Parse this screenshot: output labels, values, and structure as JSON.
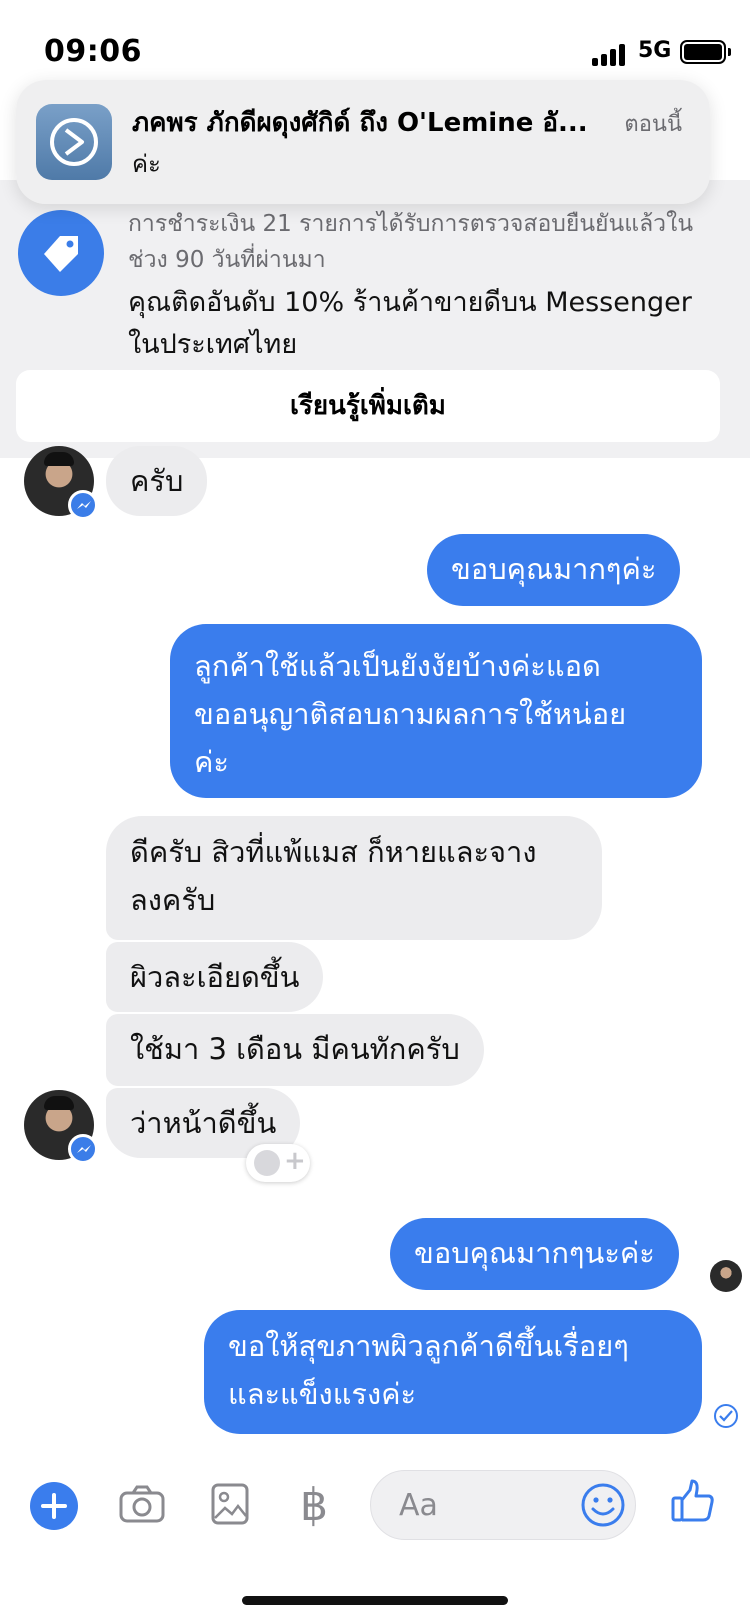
{
  "status_bar": {
    "time": "09:06",
    "network": "5G"
  },
  "notification": {
    "title": "ภคพร ภักดีผดุงศักิด์ ถึง O'Lemine อั...",
    "body": "ค่ะ",
    "time": "ตอนนี้"
  },
  "banner": {
    "verify_text": "การชำระเงิน 21 รายการได้รับการตรวจสอบยืนยันแล้วในช่วง 90 วันที่ผ่านมา",
    "rank_text": "คุณติดอันดับ 10% ร้านค้าขายดีบน Messenger ในประเทศไทย",
    "learn_more": "เรียนรู้เพิ่มเติม"
  },
  "messages": [
    {
      "side": "incoming",
      "text": "ครับ"
    },
    {
      "side": "outgoing",
      "text": "ขอบคุณมากๆค่ะ"
    },
    {
      "side": "outgoing",
      "lines": [
        "ลูกค้าใช้แล้วเป็นยังงัยบ้างค่ะแอด",
        "ขออนุญาติสอบถามผลการใช้หน่อย",
        "ค่ะ"
      ]
    },
    {
      "side": "incoming",
      "lines": [
        "ดีครับ สิวที่แพ้แมส ก็หายและจาง",
        "ลงครับ"
      ]
    },
    {
      "side": "incoming",
      "text": "ผิวละเอียดขึ้น"
    },
    {
      "side": "incoming",
      "text": "ใช้มา 3 เดือน มีคนทักครับ"
    },
    {
      "side": "incoming",
      "text": "ว่าหน้าดีขึ้น"
    },
    {
      "side": "outgoing",
      "text": "ขอบคุณมากๆนะค่ะ"
    },
    {
      "side": "outgoing",
      "lines": [
        "ขอให้สุขภาพผิวลูกค้าดีขึ้นเรื่อยๆ",
        "และแข็งแรงค่ะ"
      ]
    }
  ],
  "composer": {
    "placeholder": "Aa",
    "currency_symbol": "฿"
  },
  "colors": {
    "accent": "#3a7ded",
    "incoming_bubble": "#ececee",
    "banner_bg": "#f0f0f2"
  }
}
